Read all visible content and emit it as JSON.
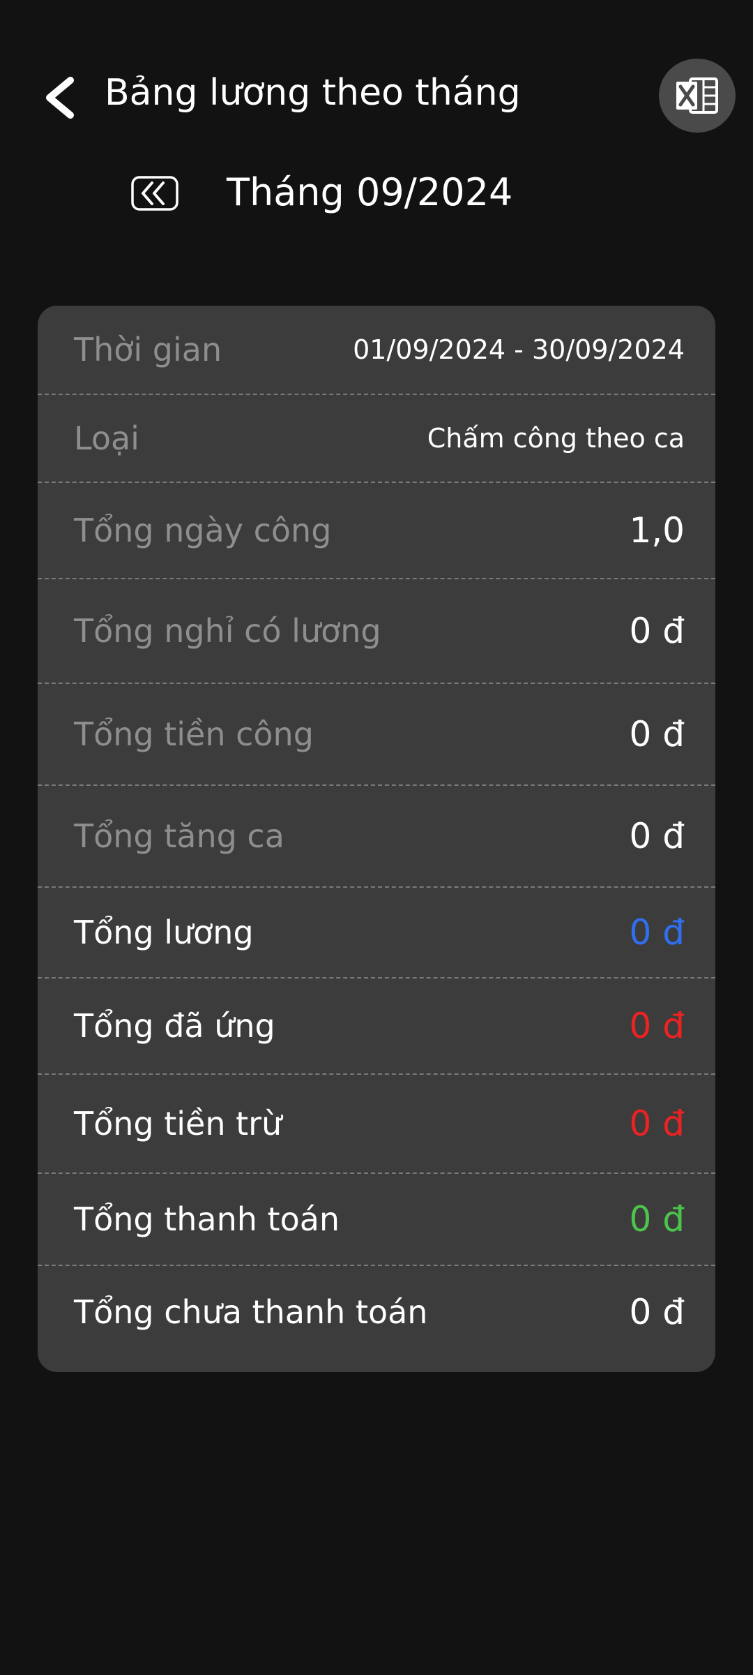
{
  "header": {
    "title": "Bảng lương theo tháng",
    "back_icon": "chevron-left-icon",
    "excel_icon": "excel-export-icon"
  },
  "month_bar": {
    "prev_icon": "double-chevron-left-icon",
    "label": "Tháng 09/2024"
  },
  "colors": {
    "background": "#121212",
    "card": "#3c3c3c",
    "blue": "#2f6ff0",
    "red": "#ee2222",
    "green": "#4cc44c",
    "muted_label": "#8e8e8e"
  },
  "summary": {
    "time": {
      "label": "Thời gian",
      "value": "01/09/2024 - 30/09/2024"
    },
    "type": {
      "label": "Loại",
      "value": "Chấm công theo ca"
    },
    "work_days": {
      "label": "Tổng ngày công",
      "value": "1,0"
    },
    "paid_leave": {
      "label": "Tổng nghỉ có lương",
      "value": "0 đ"
    },
    "wages": {
      "label": "Tổng tiền công",
      "value": "0 đ"
    },
    "overtime": {
      "label": "Tổng tăng ca",
      "value": "0 đ"
    },
    "total_salary": {
      "label": "Tổng lương",
      "value": "0 đ"
    },
    "advanced": {
      "label": "Tổng đã ứng",
      "value": "0 đ"
    },
    "deductions": {
      "label": "Tổng tiền trừ",
      "value": "0 đ"
    },
    "paid": {
      "label": "Tổng thanh toán",
      "value": "0 đ"
    },
    "unpaid": {
      "label": "Tổng chưa thanh toán",
      "value": "0 đ"
    }
  }
}
